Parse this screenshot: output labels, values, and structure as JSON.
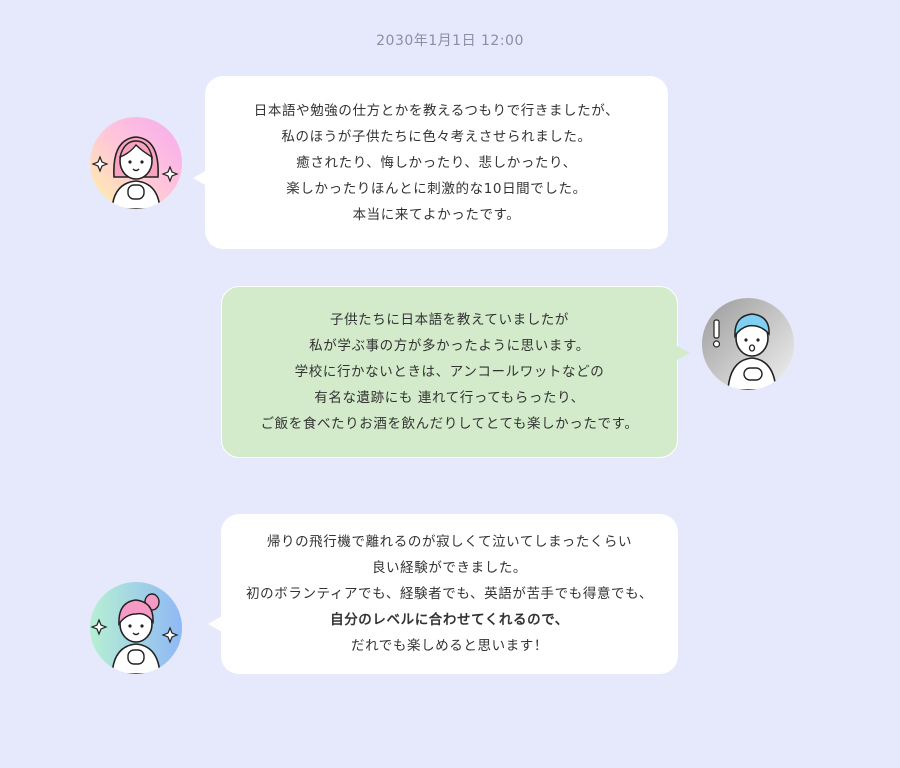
{
  "timestamp": "2030年1月1日 12:00",
  "messages": [
    {
      "speaker": "left",
      "avatar_icon": "girl-sparkles-icon",
      "lines": [
        "日本語や勉強の仕方とかを教えるつもりで行きましたが、",
        "私のほうが子供たちに色々考えさせられました。",
        "癒されたり、悔しかったり、悲しかったり、",
        "楽しかったりほんとに刺激的な10日間でした。",
        "本当に来てよかったです。"
      ]
    },
    {
      "speaker": "right",
      "avatar_icon": "boy-surprised-icon",
      "lines": [
        "子供たちに日本語を教えていましたが",
        "私が学ぶ事の方が多かったように思います。",
        "学校に行かないときは、アンコールワットなどの",
        "有名な遺跡にも 連れて行ってもらったり、",
        "ご飯を食べたりお酒を飲んだりしてとても楽しかったです。"
      ]
    },
    {
      "speaker": "left",
      "avatar_icon": "girl-ponytail-icon",
      "lines": [
        "帰りの飛行機で離れるのが寂しくて泣いてしまったくらい",
        "良い経験ができました。",
        "初のボランティアでも、経験者でも、英語が苦手でも得意でも、",
        "自分のレベルに合わせてくれるので、",
        "だれでも楽しめると思います！"
      ]
    }
  ],
  "colors": {
    "background": "#e5e9fb",
    "bubble_white": "#ffffff",
    "bubble_green": "#d3ebcb",
    "text": "#333333",
    "timestamp": "#8a8fa3"
  }
}
